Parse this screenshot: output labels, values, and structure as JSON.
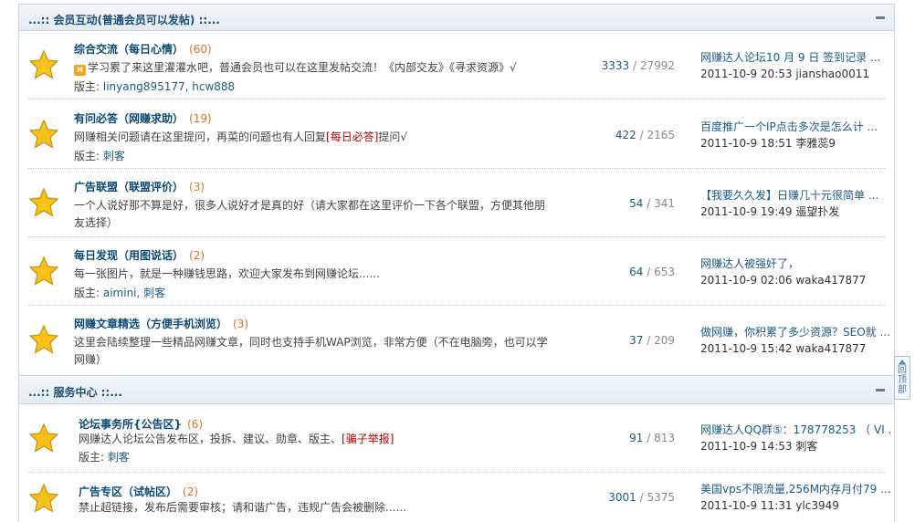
{
  "categories": [
    {
      "title": "...:: 会员互动(普通会员可以发帖) ::...",
      "forums": [
        {
          "name": "综合交流（每日心情）",
          "count": "(60)",
          "desc_parts": [
            {
              "t": "学习累了来这里灌灌水吧，普通会员也可以在这里发帖交流！《内部交友》《寻求资源》√",
              "c": ""
            }
          ],
          "has_tag": true,
          "tag": "H",
          "mods_label": "版主: ",
          "mods": "linyang895177, hcw888",
          "threads": "3333",
          "posts": "27992",
          "last_title": "网赚达人论坛10 月 9 日 签到记录 ...",
          "last_meta": "2011-10-9 20:53 jianshao0011"
        },
        {
          "name": "有问必答（网赚求助）",
          "count": "(19)",
          "desc_parts": [
            {
              "t": "网赚相关问题请在这里提问，再菜的问题也有人回复",
              "c": ""
            },
            {
              "t": "[每日必答]",
              "c": "hl"
            },
            {
              "t": "提问√",
              "c": ""
            }
          ],
          "has_tag": false,
          "mods_label": "版主: ",
          "mods": "刺客",
          "threads": "422",
          "posts": "2165",
          "last_title": "百度推广一个IP点击多次是怎么计 ...",
          "last_meta": "2011-10-9 18:51 李雅蕊9"
        },
        {
          "name": "广告联盟（联盟评价）",
          "count": "(3)",
          "desc_parts": [
            {
              "t": "一个人说好那不算是好，很多人说好才是真的好（请大家都在这里评价一下各个联盟，方便其他朋友选择）",
              "c": ""
            }
          ],
          "has_tag": false,
          "mods_label": "",
          "mods": "",
          "threads": "54",
          "posts": "341",
          "last_title": "【我要久久发】日赚几十元很简单 ...",
          "last_meta": "2011-10-9 19:49 遥望扑发"
        },
        {
          "name": "每日发现（用图说话）",
          "count": "(2)",
          "desc_parts": [
            {
              "t": "每一张图片，就是一种赚钱思路，欢迎大家发布到网赚论坛......",
              "c": ""
            }
          ],
          "has_tag": false,
          "mods_label": "版主: ",
          "mods": "aimini, 刺客",
          "threads": "64",
          "posts": "653",
          "last_title": "网赚达人被强奸了，",
          "last_meta": "2011-10-9 02:06 waka417877"
        },
        {
          "name": "网赚文章精选（方便手机浏览）",
          "count": "(3)",
          "desc_parts": [
            {
              "t": "这里会陆续整理一些精品网赚文章，同时也支持手机WAP浏览，非常方便（不在电脑旁，也可以学网赚）",
              "c": ""
            }
          ],
          "has_tag": false,
          "mods_label": "",
          "mods": "",
          "threads": "37",
          "posts": "209",
          "last_title": "做网赚，你积累了多少资源？SEO就 ...",
          "last_meta": "2011-10-9 15:42 waka417877"
        }
      ]
    },
    {
      "title": "...:: 服务中心 ::...",
      "forums": [
        {
          "name": "论坛事务所{公告区}",
          "count": "(6)",
          "desc_parts": [
            {
              "t": "网赚达人论坛公告发布区，投拆、建议、勋章、版主、",
              "c": ""
            },
            {
              "t": "[骗子举报]",
              "c": "hl"
            }
          ],
          "has_tag": false,
          "mods_label": "版主: ",
          "mods": "刺客",
          "threads": "91",
          "posts": "813",
          "last_title": "网赚达人QQ群⑤：178778253 （ VI ...",
          "last_meta": "2011-10-9 14:53 刺客"
        },
        {
          "name": "广告专区（试帖区）",
          "count": "(2)",
          "desc_parts": [
            {
              "t": "禁止超链接，发布后需要审核；请和谐广告，违规广告会被删除......",
              "c": ""
            }
          ],
          "has_tag": false,
          "mods_label": "",
          "mods": "",
          "threads": "3001",
          "posts": "5375",
          "last_title": "美国vps不限流量,256M内存月付79 ...",
          "last_meta": "2011-10-9 11:31 ylc3949"
        }
      ]
    }
  ],
  "back_to_top": "回顶部",
  "colors": {
    "accent": "#0b4a76",
    "count": "#e0702a",
    "highlight": "#c00000",
    "star": "#f6c21b"
  }
}
